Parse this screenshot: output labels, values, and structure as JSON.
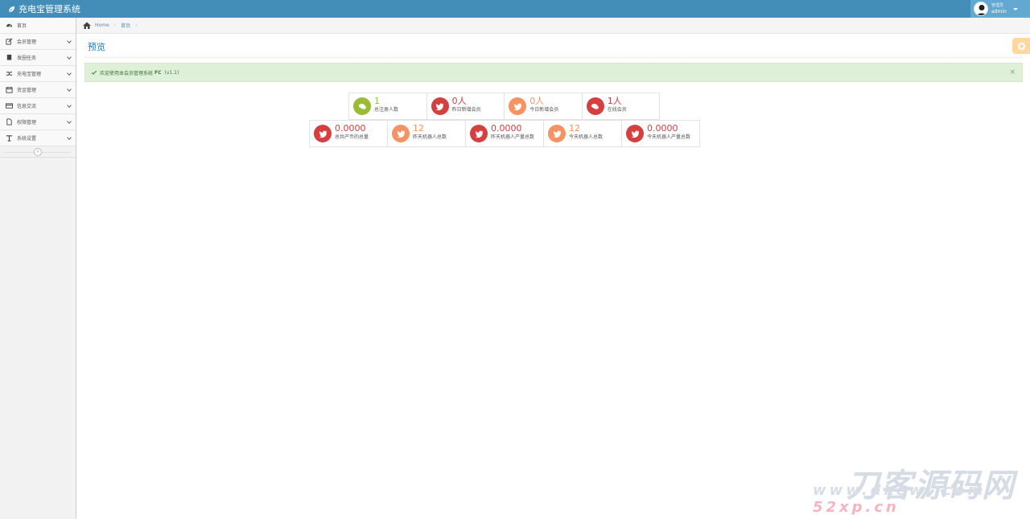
{
  "app": {
    "title": "充电宝管理系统"
  },
  "user": {
    "role": "管理员",
    "name": "admin"
  },
  "sidebar": {
    "items": [
      {
        "label": "首页",
        "icon": "dashboard-icon",
        "has_children": false
      },
      {
        "label": "会员管理",
        "icon": "edit-icon",
        "has_children": true
      },
      {
        "label": "发圈任务",
        "icon": "book-icon",
        "has_children": true
      },
      {
        "label": "充电宝管理",
        "icon": "random-icon",
        "has_children": true
      },
      {
        "label": "资金管理",
        "icon": "calendar-icon",
        "has_children": true
      },
      {
        "label": "信息交流",
        "icon": "credit-card-icon",
        "has_children": true
      },
      {
        "label": "权限管理",
        "icon": "file-icon",
        "has_children": true
      },
      {
        "label": "系统设置",
        "icon": "text-icon",
        "has_children": true
      }
    ],
    "collapse_label": "«"
  },
  "breadcrumb": {
    "home": "Home",
    "current": "首页"
  },
  "page": {
    "title": "预览"
  },
  "alert": {
    "text": "欢迎使用本会员管理系统",
    "accent": "FC",
    "version": "(v1.1)",
    "close": "×"
  },
  "stats_row1": [
    {
      "value": "1",
      "label": "总注册人数",
      "color": "#9abc32",
      "icon": "comments-icon"
    },
    {
      "value": "0人",
      "label": "昨日新增会员",
      "color": "#d53f40",
      "icon": "twitter-icon"
    },
    {
      "value": "0人",
      "label": "今日新增会员",
      "color": "#f79263",
      "icon": "twitter-icon"
    },
    {
      "value": "1人",
      "label": "在线会员",
      "color": "#d53f40",
      "icon": "comments-icon"
    }
  ],
  "stats_row2": [
    {
      "value": "0.0000",
      "label": "总共产币的总量",
      "color": "#d53f40",
      "icon": "twitter-icon"
    },
    {
      "value": "12",
      "label": "昨天机器人总数",
      "color": "#f79263",
      "icon": "twitter-icon"
    },
    {
      "value": "0.0000",
      "label": "昨天机器人产量总数",
      "color": "#d53f40",
      "icon": "twitter-icon"
    },
    {
      "value": "12",
      "label": "今天机器人总数",
      "color": "#f79263",
      "icon": "twitter-icon"
    },
    {
      "value": "0.0000",
      "label": "今天机器人产量总数",
      "color": "#d53f40",
      "icon": "twitter-icon"
    }
  ],
  "watermark": {
    "main": "刀客源码网",
    "url_prefix": "www.dkewl.com",
    "url_suffix": "52xp.cn"
  },
  "colors": {
    "navbar": "#438eb9",
    "accent_blue": "#2679b5",
    "alert_bg": "#dff0d8"
  }
}
